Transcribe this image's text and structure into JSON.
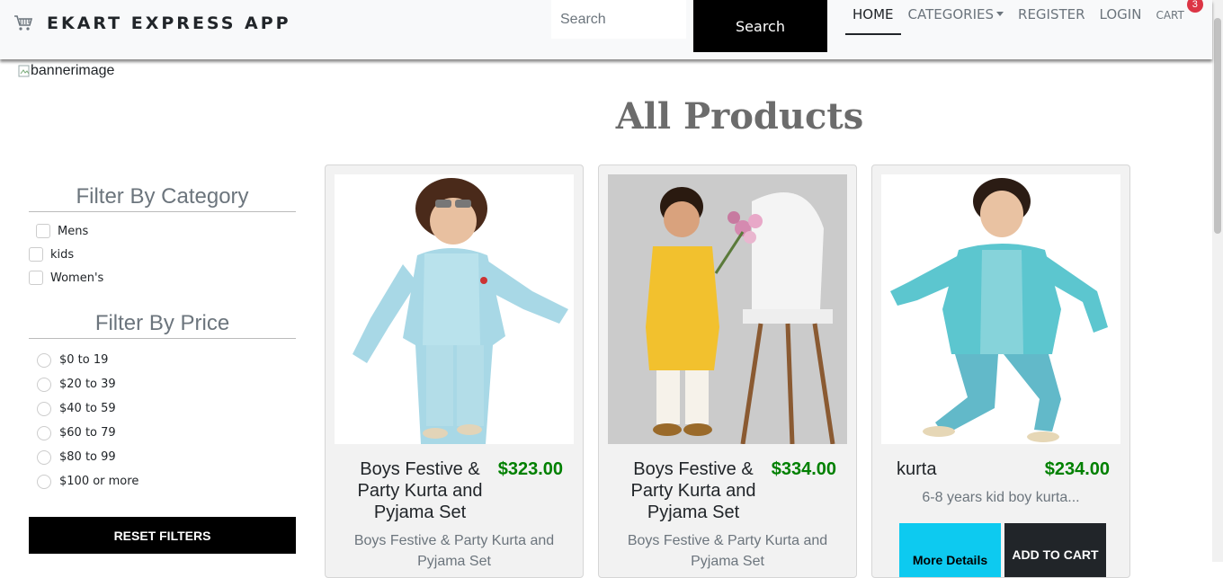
{
  "brand": {
    "name": "EKART EXPRESS APP",
    "icon": "shopping-cart-icon"
  },
  "search": {
    "placeholder": "Search",
    "button_label": "Search"
  },
  "nav": {
    "home": "HOME",
    "categories": "CATEGORIES",
    "register": "REGISTER",
    "login": "LOGIN",
    "cart": "CART",
    "cart_count": "3"
  },
  "banner": {
    "alt": "bannerimage"
  },
  "page_title": "All Products",
  "filters": {
    "category_heading": "Filter By Category",
    "categories": [
      "Mens",
      "kids",
      "Women's"
    ],
    "price_heading": "Filter By Price",
    "prices": [
      "$0 to 19",
      "$20 to 39",
      "$40 to 59",
      "$60 to 79",
      "$80 to 99",
      "$100 or more"
    ],
    "reset_label": "RESET FILTERS"
  },
  "products": [
    {
      "name": "Boys Festive & Party Kurta and Pyjama Set",
      "price": "$323.00",
      "description": "Boys Festive & Party Kurta and Pyjama Set"
    },
    {
      "name": "Boys Festive & Party Kurta and Pyjama Set",
      "price": "$334.00",
      "description": "Boys Festive & Party Kurta and Pyjama Set"
    },
    {
      "name": "kurta",
      "price": "$234.00",
      "description": "6-8 years kid boy kurta...",
      "more_label": "More Details",
      "add_label": "ADD TO CART"
    }
  ],
  "colors": {
    "accent_price": "#008000",
    "more_button": "#0dcaf0",
    "badge": "#dc3545"
  }
}
